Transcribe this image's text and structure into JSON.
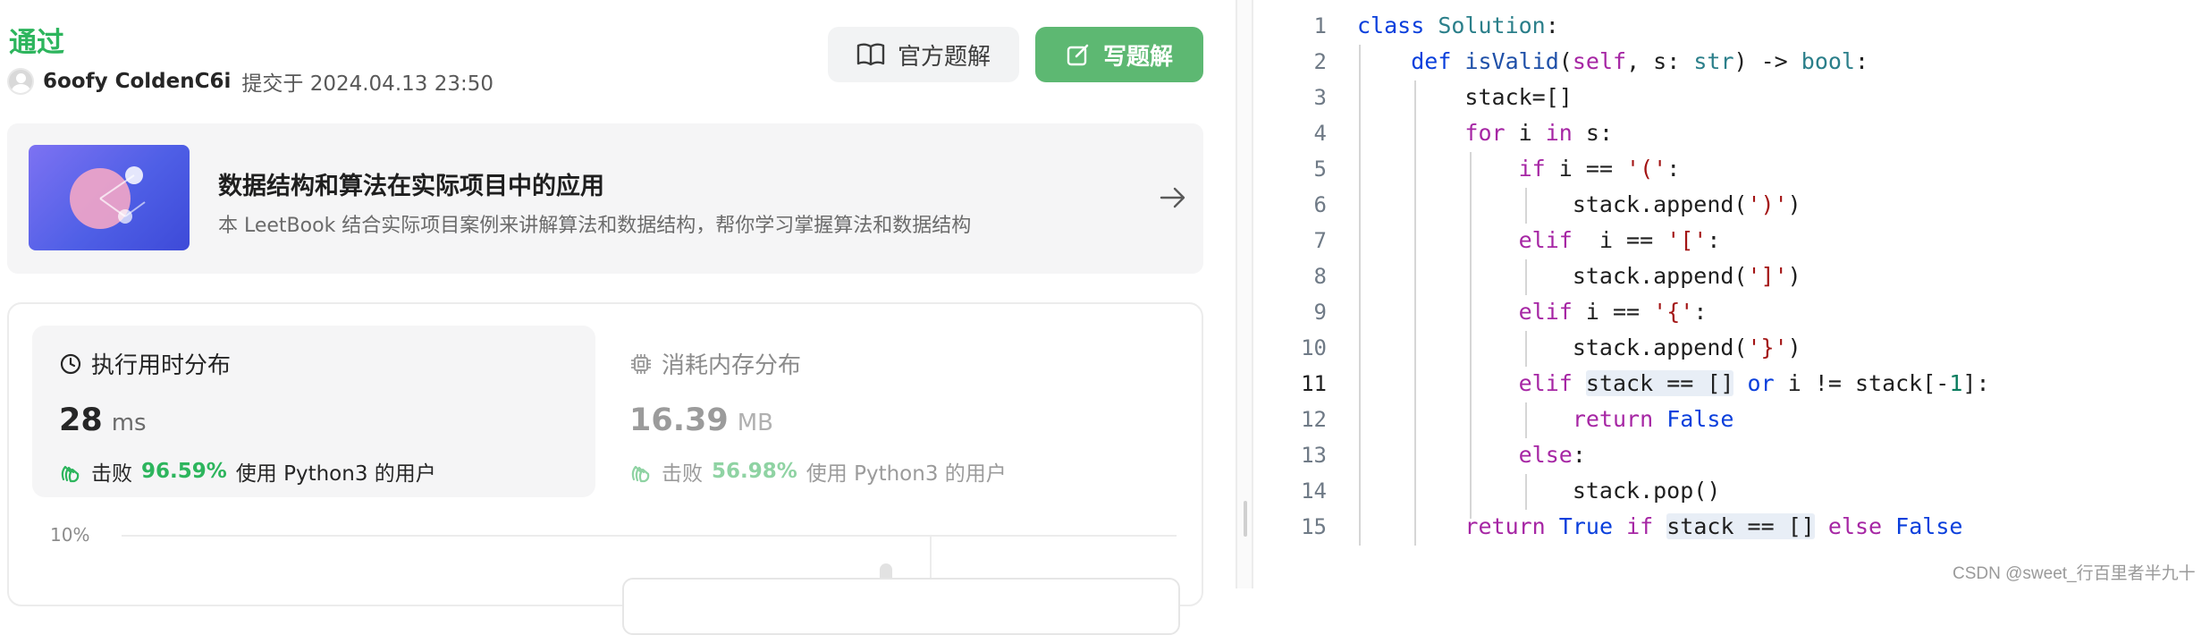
{
  "submission": {
    "status": "通过",
    "username": "6oofy ColdenC6i",
    "submit_meta": "提交于 2024.04.13 23:50"
  },
  "actions": {
    "official_solution": "官方题解",
    "write_solution": "写题解"
  },
  "banner": {
    "title": "数据结构和算法在实际项目中的应用",
    "description": "本 LeetBook 结合实际项目案例来讲解算法和数据结构，帮你学习掌握算法和数据结构"
  },
  "runtime": {
    "label": "执行用时分布",
    "value": "28",
    "unit": "ms",
    "beat_prefix": "击败",
    "beat_percent": "96.59%",
    "beat_suffix": "使用 Python3 的用户"
  },
  "memory": {
    "label": "消耗内存分布",
    "value": "16.39",
    "unit": "MB",
    "beat_prefix": "击败",
    "beat_percent": "56.98%",
    "beat_suffix": "使用 Python3 的用户"
  },
  "chart": {
    "y_tick": "10%"
  },
  "code": {
    "line_numbers": [
      "1",
      "2",
      "3",
      "4",
      "5",
      "6",
      "7",
      "8",
      "9",
      "10",
      "11",
      "12",
      "13",
      "14",
      "15"
    ],
    "active_line": "11"
  },
  "watermark": "CSDN @sweet_行百里者半九十",
  "colors": {
    "accepted": "#2db55d",
    "write_button": "#5db872",
    "keyword_blue": "#0a3fdc",
    "keyword_purple": "#a626a4",
    "string_red": "#a31515"
  }
}
